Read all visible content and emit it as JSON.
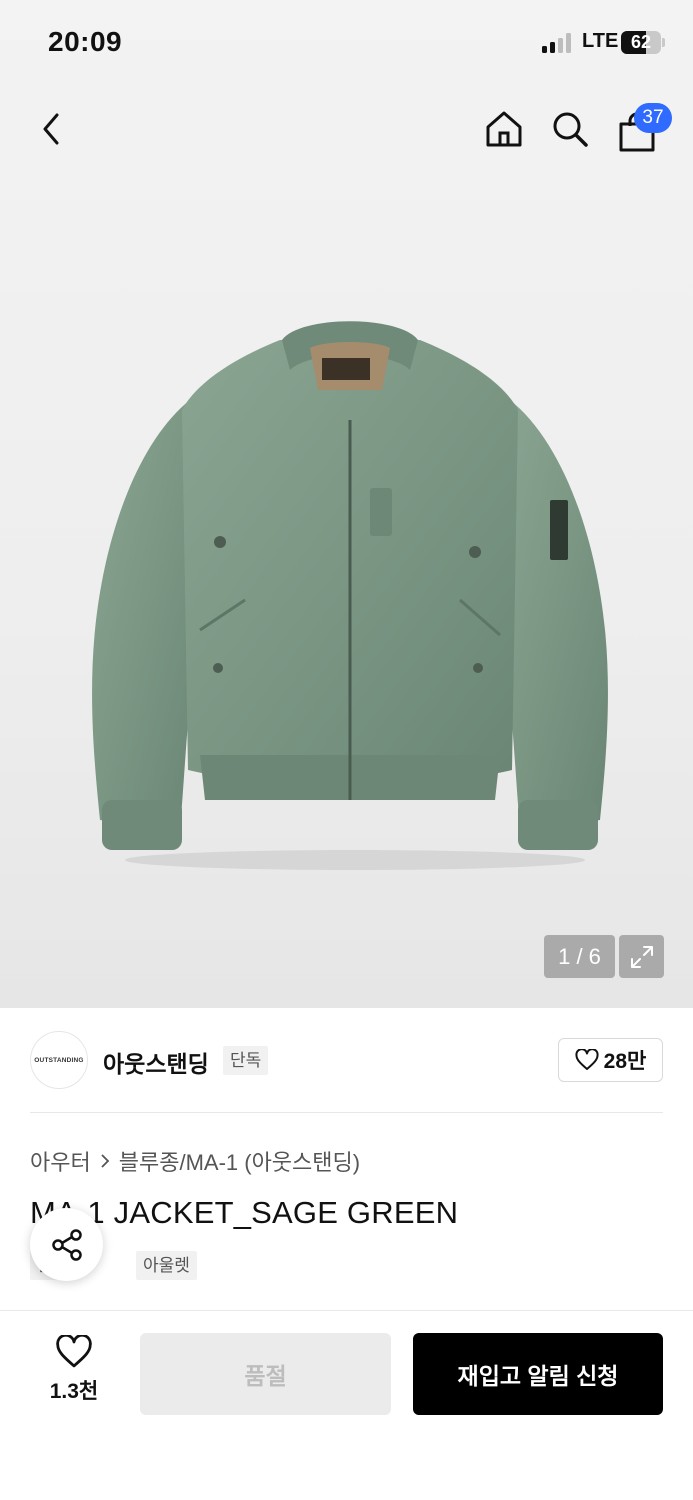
{
  "status_bar": {
    "time": "20:09",
    "network": "LTE",
    "battery": "62",
    "battery_level": 0.62
  },
  "header": {
    "back_icon": "chevron-left-icon",
    "home_icon": "home-icon",
    "search_icon": "search-icon",
    "cart_icon": "shopping-bag-icon",
    "cart_count": "37",
    "badge_color": "#2f6bff"
  },
  "gallery": {
    "counter": "1 / 6",
    "expand_icon": "expand-icon",
    "current_index": 1,
    "total": 6
  },
  "brand": {
    "logo_text": "OUTSTANDING",
    "name": "아웃스탠딩",
    "badge": "단독",
    "like_count": "28만",
    "like_icon": "heart-outline-icon"
  },
  "product": {
    "breadcrumb": [
      "아우터",
      "블루종/MA-1 (아웃스탠딩)"
    ],
    "title": "MA-1 JACKET_SAGE GREEN",
    "tags": [
      "단독",
      "아울렛"
    ],
    "jacket_color": "#7e9a86"
  },
  "share": {
    "icon": "share-icon"
  },
  "bottom_bar": {
    "wish_count": "1.3천",
    "wish_icon": "heart-outline-icon",
    "soldout_label": "품절",
    "restock_label": "재입고 알림 신청"
  }
}
